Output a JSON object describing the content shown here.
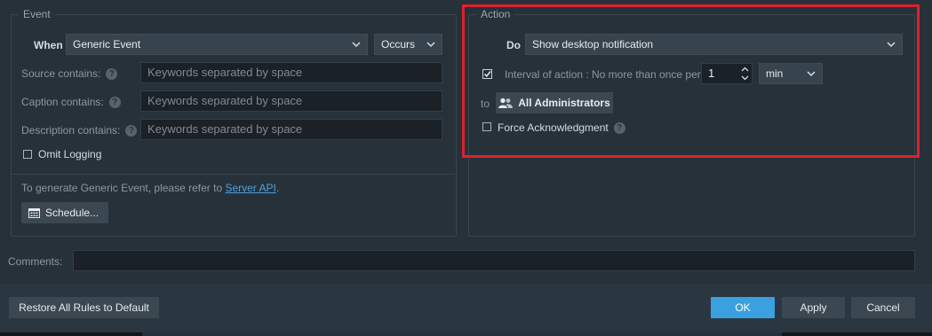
{
  "event": {
    "legend": "Event",
    "when_label": "When",
    "when_value": "Generic Event",
    "occurs_value": "Occurs",
    "source_label": "Source contains:",
    "caption_label": "Caption contains:",
    "description_label": "Description contains:",
    "keyword_placeholder": "Keywords separated by space",
    "omit_logging_label": "Omit Logging",
    "omit_logging_checked": false,
    "info_text": "To generate Generic Event, please refer to ",
    "info_link": "Server API",
    "info_suffix": ".",
    "schedule_label": "Schedule..."
  },
  "action": {
    "legend": "Action",
    "do_label": "Do",
    "do_value": "Show desktop notification",
    "interval_checked": true,
    "interval_label": "Interval of action :",
    "interval_text": "No more than once per",
    "interval_value": "1",
    "interval_unit": "min",
    "to_label": "to",
    "recipient_label": "All Administrators",
    "force_ack_label": "Force Acknowledgment",
    "force_ack_checked": false
  },
  "comments": {
    "label": "Comments:",
    "value": ""
  },
  "footer": {
    "restore_label": "Restore All Rules to Default",
    "ok_label": "OK",
    "apply_label": "Apply",
    "cancel_label": "Cancel"
  },
  "colors": {
    "background": "#26313a",
    "primary_button": "#3aa0e0",
    "highlight_border": "#e0202a"
  }
}
